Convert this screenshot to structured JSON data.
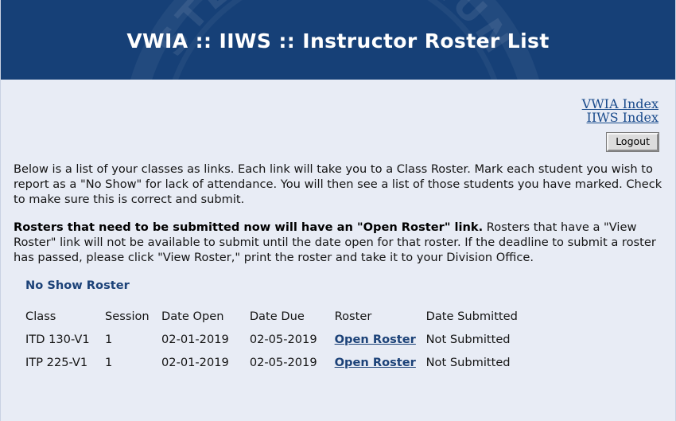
{
  "header": {
    "title": "VWIA :: IIWS :: Instructor Roster List",
    "seal_text": "STERN COMMUN",
    "background_color": "#164077"
  },
  "nav": {
    "links": [
      {
        "label": "VWIA Index"
      },
      {
        "label": "IIWS Index"
      }
    ],
    "logout_label": "Logout"
  },
  "instructions": {
    "paragraph1": "Below is a list of your classes as links. Each link will take you to a Class Roster. Mark each student you wish to report as a \"No Show\" for lack of attendance. You will then see a list of those students you have marked. Check to make sure this is correct and submit.",
    "paragraph2_bold": "Rosters that need to be submitted now will have an \"Open Roster\" link.",
    "paragraph2_rest": " Rosters that have a \"View Roster\" link will not be available to submit until the date open for that roster. If the deadline to submit a roster has passed, please click \"View Roster,\" print the roster and take it to your Division Office."
  },
  "roster_section": {
    "title": "No Show Roster",
    "title_color": "#1c4278",
    "columns": [
      "Class",
      "Session",
      "Date Open",
      "Date Due",
      "Roster",
      "Date Submitted"
    ],
    "rows": [
      {
        "class": "ITD 130-V1",
        "session": "1",
        "date_open": "02-01-2019",
        "date_due": "02-05-2019",
        "roster_link": "Open Roster",
        "date_submitted": "Not Submitted"
      },
      {
        "class": "ITP 225-V1",
        "session": "1",
        "date_open": "02-01-2019",
        "date_due": "02-05-2019",
        "roster_link": "Open Roster",
        "date_submitted": "Not Submitted"
      }
    ]
  },
  "colors": {
    "page_background": "#e8ecf5",
    "link_blue": "#1a4b8c",
    "navy": "#1c4278"
  }
}
